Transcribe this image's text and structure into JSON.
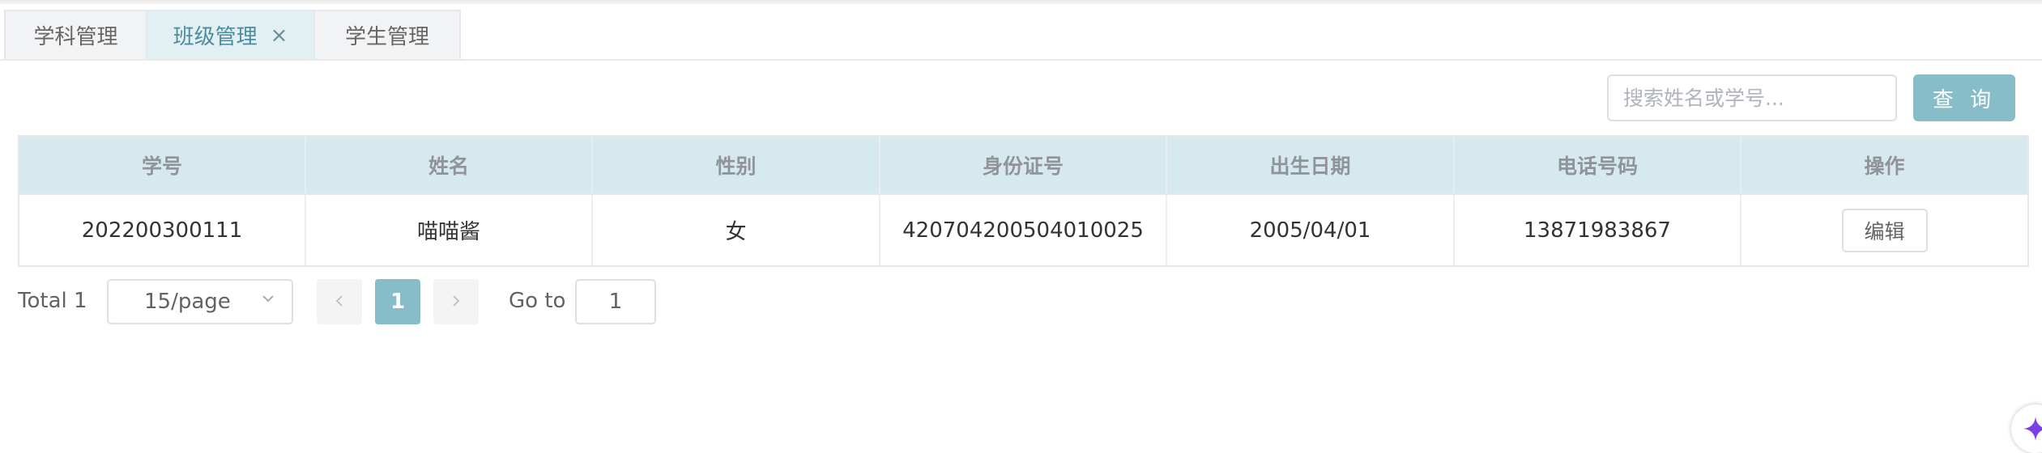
{
  "tabs": [
    {
      "label": "学科管理",
      "active": false
    },
    {
      "label": "班级管理",
      "active": true,
      "close": "×"
    },
    {
      "label": "学生管理",
      "active": false
    }
  ],
  "search": {
    "placeholder": "搜索姓名或学号...",
    "value": "",
    "button_label": "查 询"
  },
  "table": {
    "columns": [
      "学号",
      "姓名",
      "性别",
      "身份证号",
      "出生日期",
      "电话号码",
      "操作"
    ],
    "rows": [
      {
        "student_id": "202200300111",
        "name": "喵喵酱",
        "gender": "女",
        "id_card": "420704200504010025",
        "birth_date": "2005/04/01",
        "phone": "13871983867",
        "action_label": "编辑"
      }
    ]
  },
  "pagination": {
    "total_text": "Total 1",
    "page_size_text": "15/page",
    "prev_icon": "chevron-left-icon",
    "next_icon": "chevron-right-icon",
    "current_page": "1",
    "goto_label": "Go to",
    "goto_value": "1"
  },
  "colors": {
    "accent": "#87bdc8",
    "header_bg": "#d6eaee",
    "active_tab_bg": "#e2eff3",
    "active_tab_text": "#4c8c9d"
  }
}
